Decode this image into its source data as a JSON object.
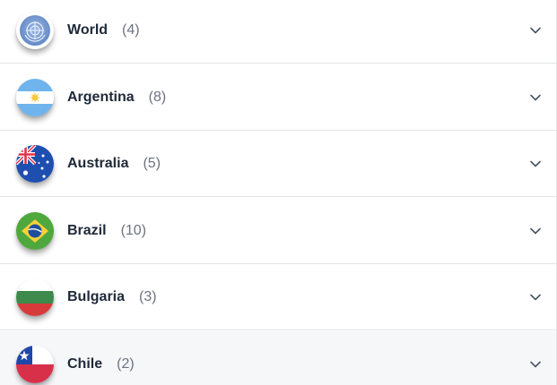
{
  "countries": [
    {
      "name": "World",
      "count": "(4)",
      "flag_icon": "un-globe-icon"
    },
    {
      "name": "Argentina",
      "count": "(8)",
      "flag_icon": "argentina-flag-icon"
    },
    {
      "name": "Australia",
      "count": "(5)",
      "flag_icon": "australia-flag-icon"
    },
    {
      "name": "Brazil",
      "count": "(10)",
      "flag_icon": "brazil-flag-icon"
    },
    {
      "name": "Bulgaria",
      "count": "(3)",
      "flag_icon": "bulgaria-flag-icon"
    },
    {
      "name": "Chile",
      "count": "(2)",
      "flag_icon": "chile-flag-icon"
    }
  ],
  "expand_icon": "chevron-down-icon",
  "colors": {
    "text": "#1f2937",
    "count": "#6b7280",
    "divider": "#e2e4e8",
    "highlight_row": "#f6f7f9"
  }
}
